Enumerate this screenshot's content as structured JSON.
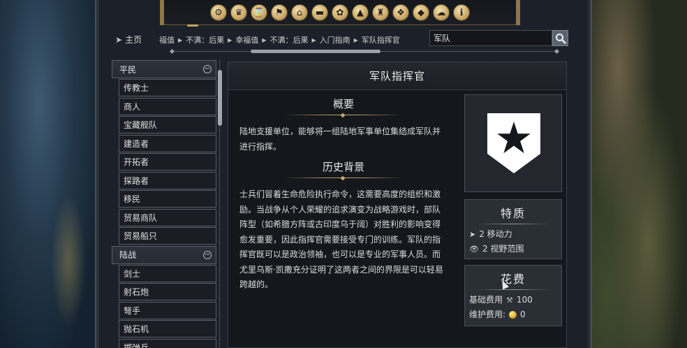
{
  "nav": {
    "home_label": "主页",
    "breadcrumbs": [
      "福值",
      "不满：后果",
      "幸福值",
      "不满：后果",
      "入门指南",
      "军队指挥官"
    ],
    "search_value": "军队"
  },
  "categories": [
    {
      "name": "game-concepts-icon",
      "glyph": "⚙"
    },
    {
      "name": "civilizations-icon",
      "glyph": "♛"
    },
    {
      "name": "leaders-icon",
      "glyph": "⌛"
    },
    {
      "name": "city-states-icon",
      "glyph": "⚑"
    },
    {
      "name": "districts-icon",
      "glyph": "⌂"
    },
    {
      "name": "buildings-icon",
      "glyph": "▬"
    },
    {
      "name": "wonders-icon",
      "glyph": "✿"
    },
    {
      "name": "improvements-icon",
      "glyph": "▲"
    },
    {
      "name": "units-icon",
      "glyph": "♜"
    },
    {
      "name": "unit-promotions-icon",
      "glyph": "❖"
    },
    {
      "name": "great-people-icon",
      "glyph": "◆"
    },
    {
      "name": "religions-icon",
      "glyph": "☁"
    },
    {
      "name": "info-icon",
      "glyph": "ℹ"
    }
  ],
  "sidebar": {
    "groups": [
      {
        "label": "平民",
        "items": [
          "传教士",
          "商人",
          "宝藏舰队",
          "建造者",
          "开拓者",
          "探路者",
          "移民",
          "贸易商队",
          "贸易船只"
        ]
      },
      {
        "label": "陆战",
        "items": [
          "剑士",
          "射石炮",
          "弩手",
          "抛石机",
          "掷弹兵"
        ]
      }
    ]
  },
  "article": {
    "title": "军队指挥官",
    "summary_heading": "概要",
    "summary_text": "陆地支援单位，能够将一组陆地军事单位集结成军队并进行指挥。",
    "history_heading": "历史背景",
    "history_text": "士兵们冒着生命危险执行命令，这需要高度的组织和激励。当战争从个人荣耀的追求演变为战略游戏时，部队阵型（如希腊方阵或古印度乌于阔）对胜利的影响变得愈发重要，因此指挥官需要接受专门的训练。军队的指挥官既可以是政治领袖，也可以是专业的军事人员。而尤里乌斯·凯撒充分证明了这两者之间的界限是可以轻易跨越的。"
  },
  "traits": {
    "title": "特质",
    "movement": "2 移动力",
    "sight": "2 视野范围"
  },
  "cost": {
    "title": "花费",
    "base_label": "基础费用",
    "base_value": "100",
    "upkeep_label": "维护费用:",
    "upkeep_value": "0"
  },
  "colors": {
    "accent_gold": "#c9a767",
    "panel": "#14171c",
    "card": "#2a2e35"
  }
}
